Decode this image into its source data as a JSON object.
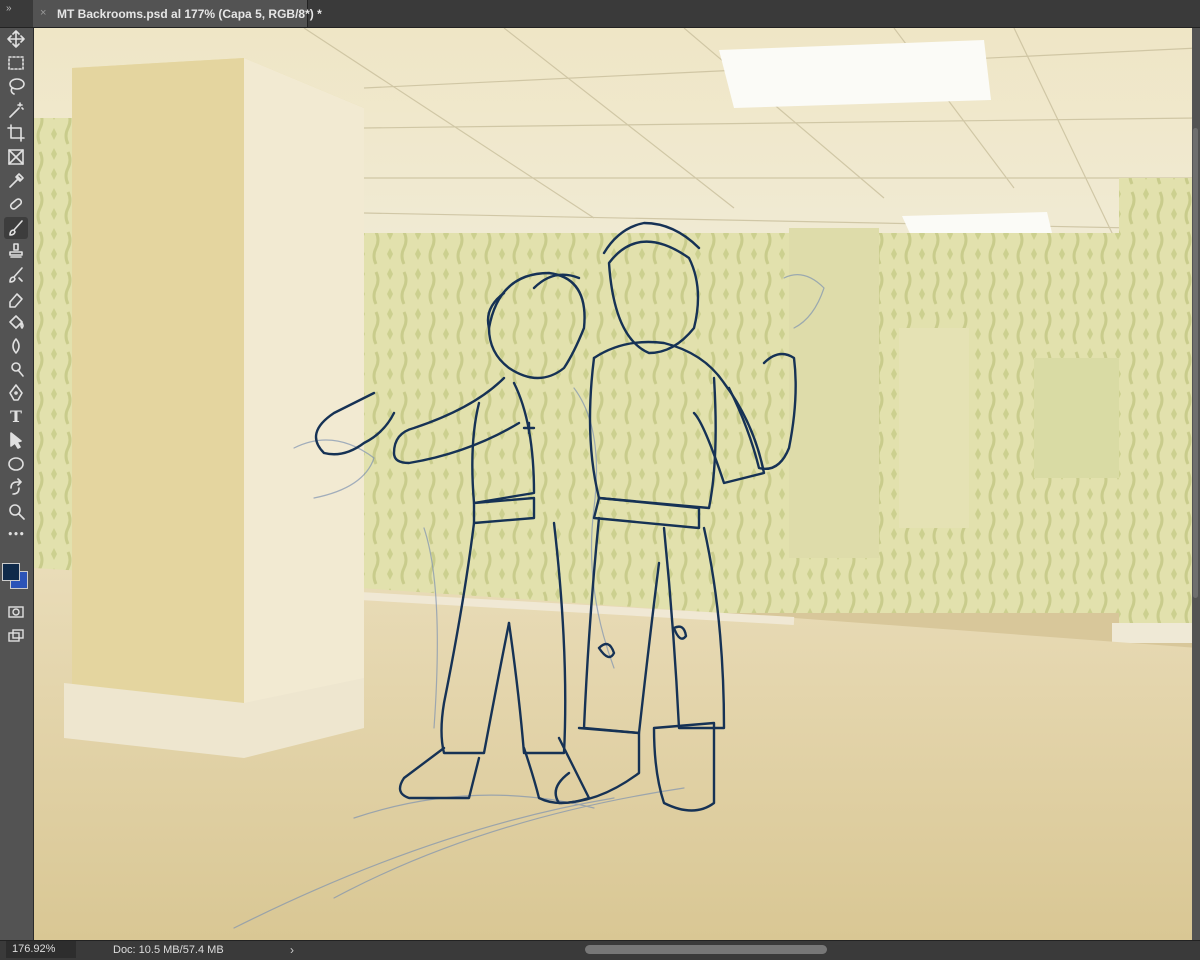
{
  "app": {
    "document_tab": {
      "title": "MT Backrooms.psd al 177% (Capa 5, RGB/8*) *",
      "close_glyph": "×"
    },
    "panel_toggle_glyph": "»"
  },
  "toolbar": {
    "tools": [
      {
        "name": "move-tool-icon"
      },
      {
        "name": "rectangular-marquee-tool-icon"
      },
      {
        "name": "lasso-tool-icon"
      },
      {
        "name": "magic-wand-tool-icon"
      },
      {
        "name": "crop-tool-icon"
      },
      {
        "name": "frame-tool-icon"
      },
      {
        "name": "eyedropper-tool-icon"
      },
      {
        "name": "spot-healing-brush-tool-icon"
      },
      {
        "name": "brush-tool-icon",
        "active": true
      },
      {
        "name": "clone-stamp-tool-icon"
      },
      {
        "name": "history-brush-tool-icon"
      },
      {
        "name": "eraser-tool-icon"
      },
      {
        "name": "paint-bucket-tool-icon"
      },
      {
        "name": "blur-tool-icon"
      },
      {
        "name": "dodge-tool-icon"
      },
      {
        "name": "pen-tool-icon"
      },
      {
        "name": "type-tool-icon",
        "glyph": "T"
      },
      {
        "name": "path-selection-tool-icon"
      },
      {
        "name": "ellipse-tool-icon"
      },
      {
        "name": "rotate-view-tool-icon"
      },
      {
        "name": "zoom-tool-icon"
      },
      {
        "name": "more-tools-icon",
        "glyph": "•••"
      }
    ],
    "foreground_color": "#0f2a4a",
    "background_color": "#2c54b8"
  },
  "status": {
    "zoom": "176.92%",
    "doc_info": "Doc: 10.5 MB/57.4 MB",
    "arrow": "›"
  },
  "colors": {
    "line_art": "#163255",
    "sketch_lines": "#6f86a6",
    "wall": "#e3e0b0",
    "floor": "#d9c99a",
    "ceiling": "#ede7cf"
  }
}
